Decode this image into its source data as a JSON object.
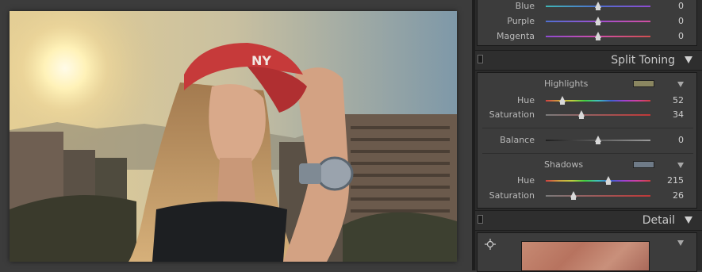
{
  "hsl_rows": [
    {
      "label": "Blue",
      "value": "0",
      "pos": 0.5,
      "gradient": "linear-gradient(90deg,#3fb5b5,#4f6fd0,#8e4bd0)"
    },
    {
      "label": "Purple",
      "value": "0",
      "pos": 0.5,
      "gradient": "linear-gradient(90deg,#4f6fd0,#a04fd0,#d04fa0)"
    },
    {
      "label": "Magenta",
      "value": "0",
      "pos": 0.5,
      "gradient": "linear-gradient(90deg,#8e4bd0,#d04fa8,#d04f4f)"
    }
  ],
  "split_toning": {
    "title": "Split Toning",
    "highlights": {
      "label": "Highlights",
      "color": "#8a8660",
      "hue": {
        "label": "Hue",
        "value": "52",
        "pos": 0.144
      },
      "saturation": {
        "label": "Saturation",
        "value": "34",
        "pos": 0.34
      }
    },
    "balance": {
      "label": "Balance",
      "value": "0",
      "pos": 0.5
    },
    "shadows": {
      "label": "Shadows",
      "color": "#6f7b88",
      "hue": {
        "label": "Hue",
        "value": "215",
        "pos": 0.597
      },
      "saturation": {
        "label": "Saturation",
        "value": "26",
        "pos": 0.26
      }
    }
  },
  "detail": {
    "title": "Detail"
  },
  "colors": {
    "hue_gradient": "linear-gradient(90deg,#d04040,#d0a040,#c0d040,#40d040,#40c0c0,#4060d0,#a040d0,#d040a0,#d04040)",
    "sat_gradient": "linear-gradient(90deg,#7a7a7a,#c03838)",
    "balance_gradient": "linear-gradient(90deg,#1f1f1f,#9a9a9a)"
  },
  "icons": {
    "panel_toggle": "panel-switch-icon",
    "collapse": "triangle-down-icon",
    "target": "target-adjustment-icon"
  }
}
